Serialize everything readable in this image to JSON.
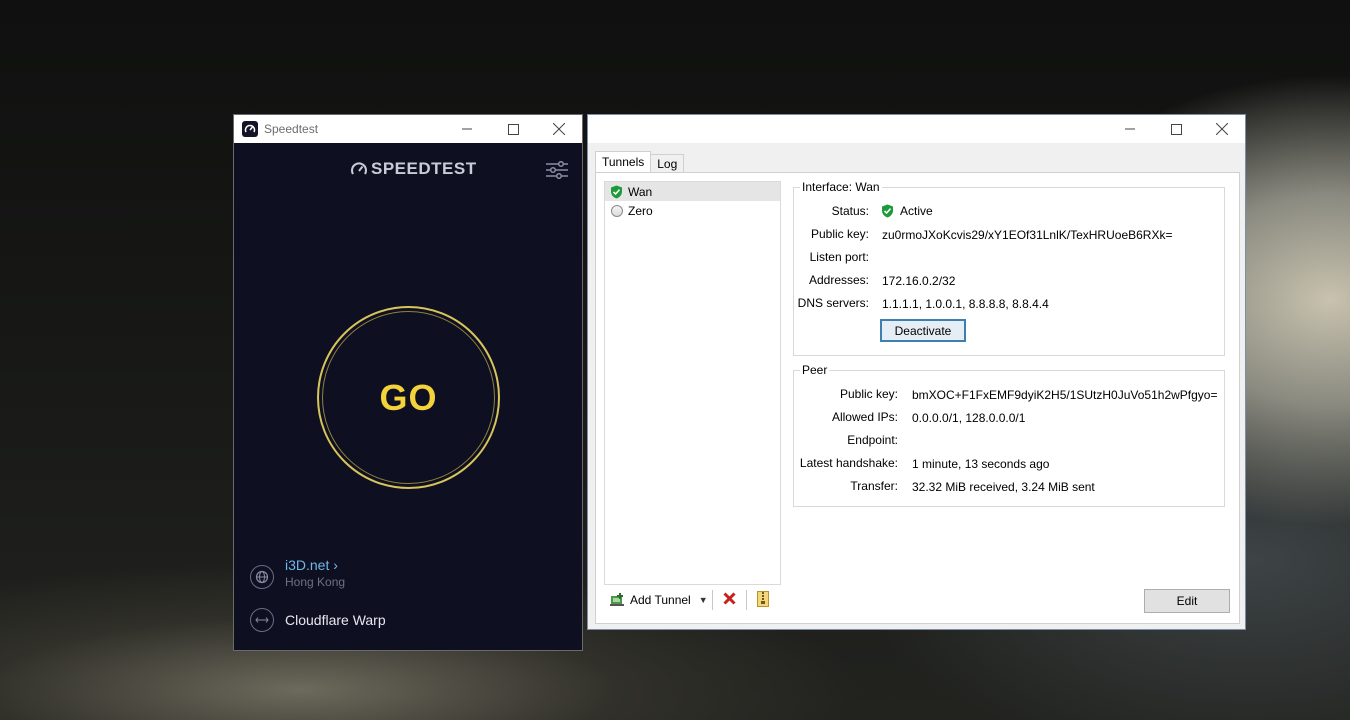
{
  "speedtest": {
    "window_title": "Speedtest",
    "logo_text": "SPEEDTEST",
    "go_label": "GO",
    "isp": {
      "name": "i3D.net",
      "chevron": "›",
      "location": "Hong Kong"
    },
    "connection": {
      "name": "Cloudflare Warp"
    },
    "colors": {
      "background": "#0f0f22",
      "go": "#f2d43a",
      "isp_link": "#6fb8e8"
    }
  },
  "wireguard": {
    "window_title": "",
    "tabs": [
      {
        "label": "Tunnels",
        "active": true
      },
      {
        "label": "Log",
        "active": false
      }
    ],
    "tunnels": [
      {
        "name": "Wan",
        "state": "active",
        "selected": true
      },
      {
        "name": "Zero",
        "state": "inactive",
        "selected": false
      }
    ],
    "toolbar": {
      "add_label": "Add Tunnel",
      "add_icon": "add-tunnel-icon",
      "delete_icon": "delete-icon",
      "export_icon": "export-zip-icon"
    },
    "interface": {
      "title": "Interface: Wan",
      "status_label": "Status:",
      "status_value": "Active",
      "public_key_label": "Public key:",
      "public_key": "zu0rmoJXoKcvis29/xY1EOf31LnlK/TexHRUoeB6RXk=",
      "listen_port_label": "Listen port:",
      "listen_port": "",
      "addresses_label": "Addresses:",
      "addresses": "172.16.0.2/32",
      "dns_label": "DNS servers:",
      "dns": "1.1.1.1, 1.0.0.1, 8.8.8.8, 8.8.4.4",
      "deactivate_label": "Deactivate"
    },
    "peer": {
      "title": "Peer",
      "public_key_label": "Public key:",
      "public_key": "bmXOC+F1FxEMF9dyiK2H5/1SUtzH0JuVo51h2wPfgyo=",
      "allowed_ips_label": "Allowed IPs:",
      "allowed_ips": "0.0.0.0/1, 128.0.0.0/1",
      "endpoint_label": "Endpoint:",
      "endpoint": "",
      "handshake_label": "Latest handshake:",
      "handshake": "1 minute, 13 seconds ago",
      "transfer_label": "Transfer:",
      "transfer": "32.32 MiB received, 3.24 MiB sent"
    },
    "edit_label": "Edit",
    "colors": {
      "active_shield": "#1d9b3a",
      "delete": "#c8201c",
      "button_focus": "#3c7fb1"
    }
  }
}
